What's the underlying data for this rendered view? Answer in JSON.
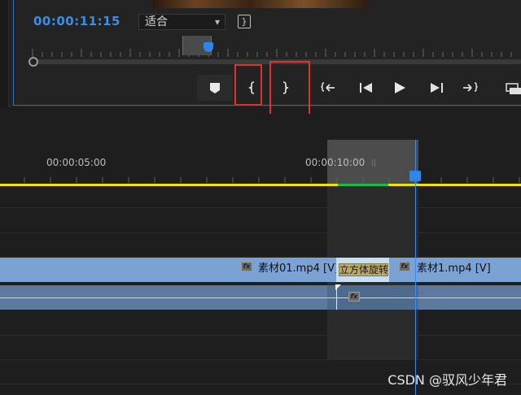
{
  "source_monitor": {
    "timecode": "00:00:11:15",
    "fit_select": {
      "value": "适合",
      "chevron": "chevron-down-icon"
    },
    "transport_buttons": [
      {
        "name": "add-marker-button",
        "glyph": "⛉"
      },
      {
        "name": "mark-in-button",
        "glyph": "{"
      },
      {
        "name": "mark-out-button",
        "glyph": "}"
      },
      {
        "name": "go-to-in-button",
        "glyph": "{⇤"
      },
      {
        "name": "step-back-button",
        "glyph": "◀|"
      },
      {
        "name": "play-button",
        "glyph": "▶"
      },
      {
        "name": "step-forward-button",
        "glyph": "|▶"
      },
      {
        "name": "go-to-out-button",
        "glyph": "⇥}"
      },
      {
        "name": "insert-button",
        "glyph": "⎘"
      }
    ],
    "highlight_color": "#e0322e"
  },
  "timeline": {
    "ruler_labels": [
      "00:00:05:00",
      "00:00:10:00"
    ],
    "video_track": {
      "clip_left_name": "素材01.mp4 [V]",
      "transition_name": "立方体旋转",
      "clip_right_name": "素材1.mp4 [V]",
      "fx_label": "fx"
    },
    "audio_track": {
      "fx_label": "fx"
    },
    "colors": {
      "video_clip": "#7aa3d4",
      "audio_clip": "#5d7a9e",
      "playhead": "#2e86e8",
      "work_bar": "#f2e10f"
    }
  },
  "watermark": "CSDN @驭风少年君"
}
